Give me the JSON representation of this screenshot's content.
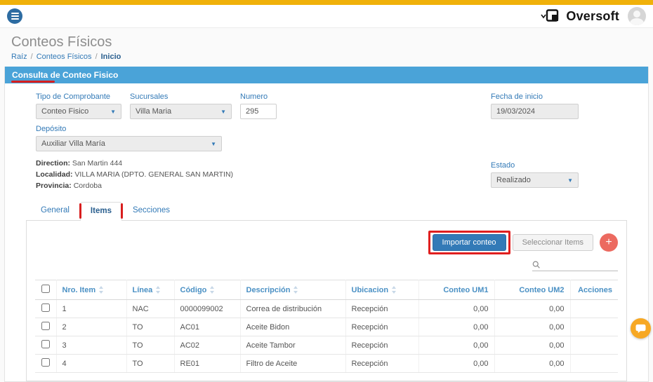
{
  "colors": {
    "topbar_yellow": "#f0b10a",
    "accent_blue": "#337ab7",
    "panel_header_blue": "#4aa3d8",
    "annotation_red": "#e01f1f",
    "chat_orange": "#f7a823",
    "add_button_red": "#ec6a60"
  },
  "header": {
    "brand": "Oversoft"
  },
  "page": {
    "title": "Conteos Físicos",
    "breadcrumb": [
      "Raíz",
      "Conteos Físicos",
      "Inicio"
    ],
    "section_title": "Consulta de Conteo Fisico"
  },
  "form": {
    "tipo_label": "Tipo de Comprobante",
    "tipo_value": "Conteo Fisico",
    "sucursales_label": "Sucursales",
    "sucursales_value": "Villa Maria",
    "numero_label": "Numero",
    "numero_value": "295",
    "fecha_label": "Fecha de inicio",
    "fecha_value": "19/03/2024",
    "deposito_label": "Depósito",
    "deposito_value": "Auxiliar Villa María",
    "direction_label": "Direction:",
    "direction_value": " San Martin 444",
    "localidad_label": "Localidad:",
    "localidad_value": " VILLA MARIA (DPTO. GENERAL SAN MARTIN)",
    "provincia_label": "Provincia:",
    "provincia_value": " Cordoba",
    "estado_label": "Estado",
    "estado_value": "Realizado"
  },
  "tabs": {
    "general": "General",
    "items": "Items",
    "secciones": "Secciones"
  },
  "toolbar": {
    "importar_label": "Importar conteo",
    "seleccionar_label": "Seleccionar Items",
    "add_label": "+"
  },
  "table": {
    "headers": [
      "Nro. Item",
      "Línea",
      "Código",
      "Descripción",
      "Ubicacion",
      "Conteo UM1",
      "Conteo UM2",
      "Acciones"
    ],
    "rows": [
      [
        "1",
        "NAC",
        "0000099002",
        "Correa de distribución",
        "Recepción",
        "0,00",
        "0,00",
        ""
      ],
      [
        "2",
        "TO",
        "AC01",
        "Aceite Bidon",
        "Recepción",
        "0,00",
        "0,00",
        ""
      ],
      [
        "3",
        "TO",
        "AC02",
        "Aceite Tambor",
        "Recepción",
        "0,00",
        "0,00",
        ""
      ],
      [
        "4",
        "TO",
        "RE01",
        "Filtro de Aceite",
        "Recepción",
        "0,00",
        "0,00",
        ""
      ]
    ]
  }
}
